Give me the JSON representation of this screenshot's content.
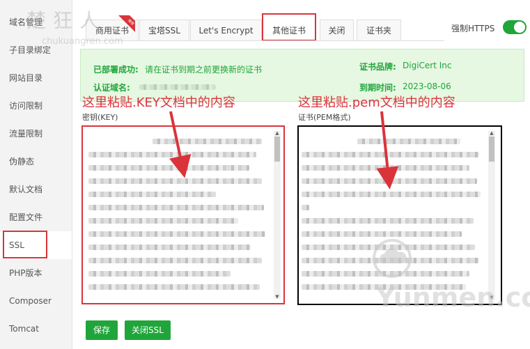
{
  "sidebar": {
    "items": [
      {
        "label": "域名管理"
      },
      {
        "label": "子目录绑定"
      },
      {
        "label": "网站目录"
      },
      {
        "label": "访问限制"
      },
      {
        "label": "流量限制"
      },
      {
        "label": "伪静态"
      },
      {
        "label": "默认文档"
      },
      {
        "label": "配置文件"
      },
      {
        "label": "SSL"
      },
      {
        "label": "PHP版本"
      },
      {
        "label": "Composer"
      },
      {
        "label": "Tomcat"
      }
    ]
  },
  "tabs": [
    {
      "label": "商用证书"
    },
    {
      "label": "宝塔SSL"
    },
    {
      "label": "Let's Encrypt"
    },
    {
      "label": "其他证书"
    },
    {
      "label": "关闭"
    },
    {
      "label": "证书夹"
    }
  ],
  "tab_badge": "推荐",
  "force_https": {
    "label": "强制HTTPS",
    "enabled": true
  },
  "info": {
    "deploy_label": "已部署成功:",
    "deploy_text": "请在证书到期之前更换新的证书",
    "brand_label": "证书品牌:",
    "brand_value": "DigiCert Inc",
    "domain_label": "认证域名:",
    "expire_label": "到期时间:",
    "expire_value": "2023-08-06"
  },
  "annotations": {
    "left": "这里粘贴.KEY文档中的内容",
    "right": "这里粘贴.pem文档中的内容"
  },
  "key_field": {
    "label": "密钥(KEY)"
  },
  "pem_field": {
    "label": "证书(PEM格式)",
    "visible_chars": [
      "M",
      "g",
      "M",
      "M",
      "3",
      "d",
      "R",
      "R",
      "A",
      "M",
      "lB",
      "ly",
      "Y",
      "Y"
    ]
  },
  "buttons": {
    "save": "保存",
    "close_ssl": "关闭SSL"
  },
  "watermarks": {
    "top": "楚狂人",
    "top_url": "chukuangren.com",
    "bottom": "Yunmen.cc"
  },
  "colors": {
    "accent_green": "#20a53a",
    "annotation_red": "#d9343a",
    "info_bg": "#e6f7e2"
  }
}
